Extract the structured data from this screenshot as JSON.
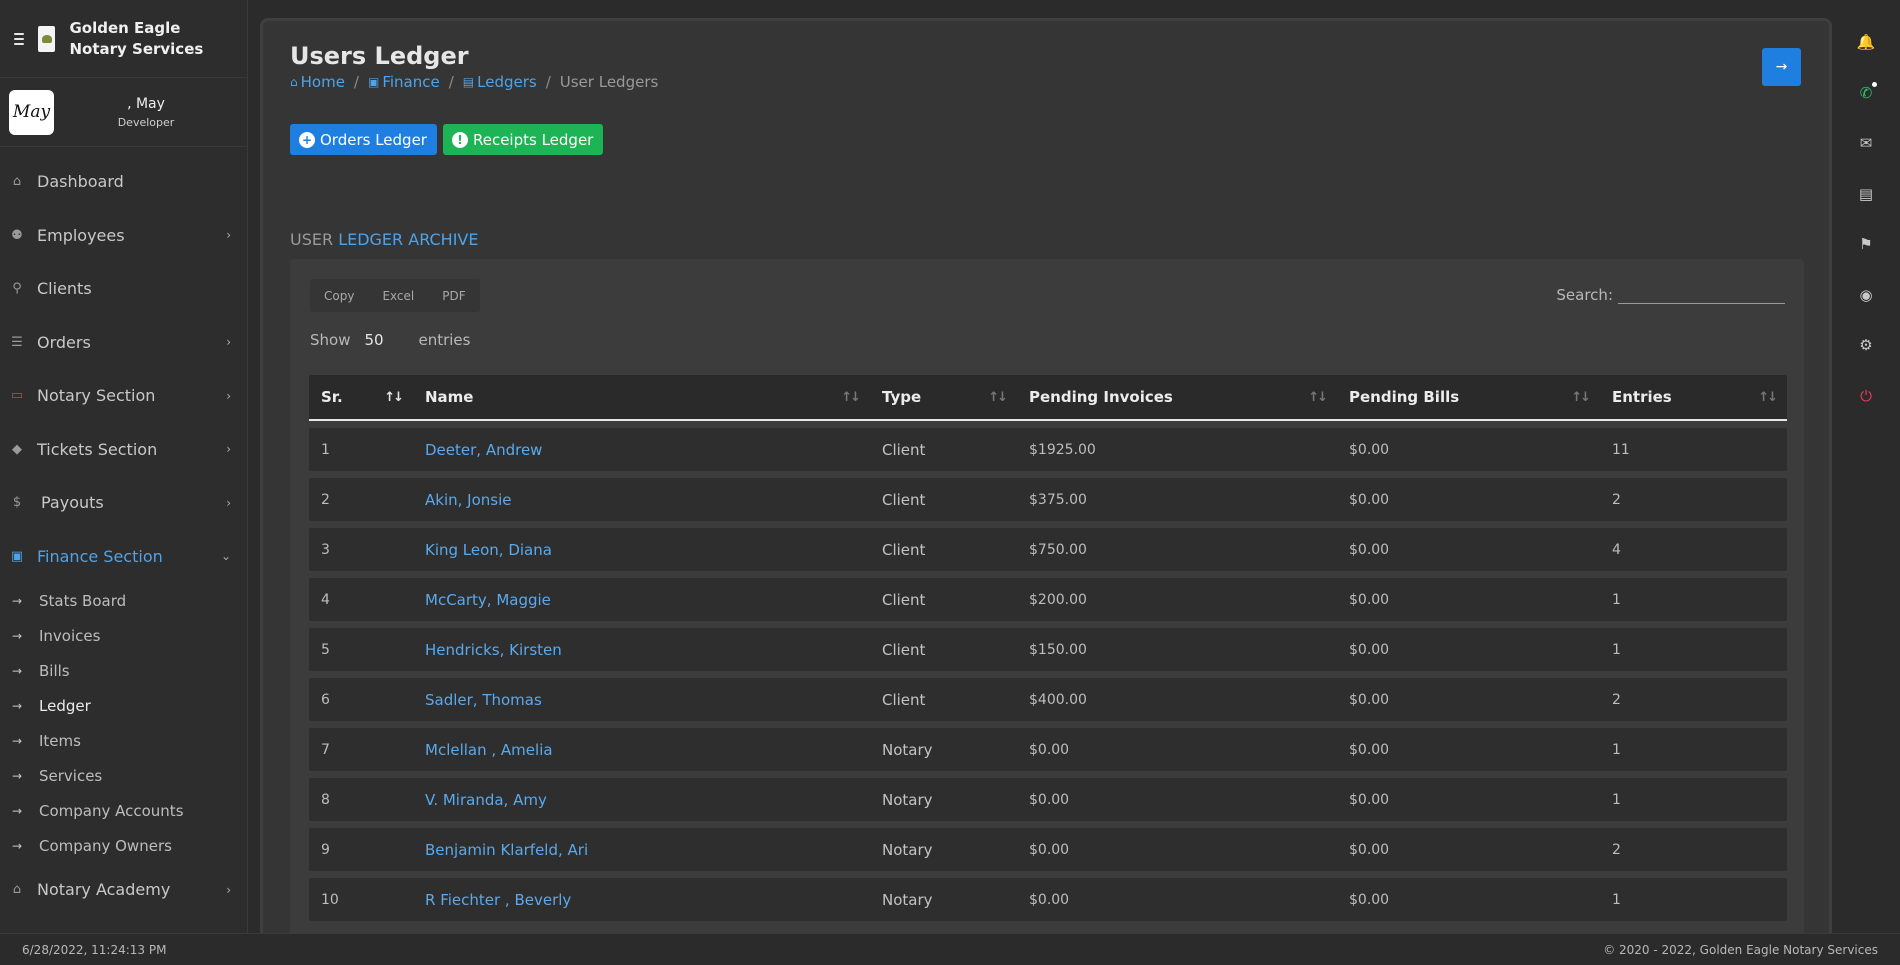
{
  "brand": {
    "name": "Golden Eagle Notary Services"
  },
  "user": {
    "name": ", May",
    "role": "Developer",
    "avatar_text": "May"
  },
  "sidebar": {
    "items": [
      {
        "label": "Dashboard",
        "icon": "home-icon",
        "glyph": "⌂",
        "chevron": ""
      },
      {
        "label": "Employees",
        "icon": "users-icon",
        "glyph": "⚉",
        "chevron": "›"
      },
      {
        "label": "Clients",
        "icon": "client-icon",
        "glyph": "⚲",
        "chevron": ""
      },
      {
        "label": "Orders",
        "icon": "orders-icon",
        "glyph": "☰",
        "chevron": "›"
      },
      {
        "label": "Notary Section",
        "icon": "id-card-icon",
        "glyph": "▭",
        "chevron": "›"
      },
      {
        "label": "Tickets Section",
        "icon": "ticket-icon",
        "glyph": "◆",
        "chevron": "›"
      },
      {
        "label": "Payouts",
        "icon": "dollar-icon",
        "glyph": "$",
        "chevron": "›"
      },
      {
        "label": "Finance Section",
        "icon": "finance-icon",
        "glyph": "▣",
        "chevron": "⌄"
      }
    ],
    "finance_sub": [
      {
        "label": "Stats Board"
      },
      {
        "label": "Invoices"
      },
      {
        "label": "Bills"
      },
      {
        "label": "Ledger"
      },
      {
        "label": "Items"
      },
      {
        "label": "Services"
      },
      {
        "label": "Company Accounts"
      },
      {
        "label": "Company Owners"
      }
    ],
    "academy": {
      "label": "Notary Academy",
      "icon": "academy-icon",
      "glyph": "⌂",
      "chevron": "›"
    },
    "sub_arrow": "→"
  },
  "header": {
    "title": "Users Ledger",
    "breadcrumb": {
      "home": "Home",
      "finance": "Finance",
      "ledgers": "Ledgers",
      "current": "User Ledgers",
      "separator": "/"
    }
  },
  "actions": {
    "orders_ledger": "Orders Ledger",
    "receipts_ledger": "Receipts Ledger"
  },
  "section": {
    "muted": "USER",
    "accent": "LEDGER ARCHIVE"
  },
  "toolbar": {
    "copy": "Copy",
    "excel": "Excel",
    "pdf": "PDF",
    "search_label": "Search:",
    "show_label": "Show",
    "show_value": "50",
    "entries_label": "entries"
  },
  "table": {
    "columns": [
      "Sr.",
      "Name",
      "Type",
      "Pending Invoices",
      "Pending Bills",
      "Entries"
    ],
    "rows": [
      {
        "sr": "1",
        "name": "Deeter, Andrew",
        "type": "Client",
        "invoices": "$1925.00",
        "bills": "$0.00",
        "entries": "11"
      },
      {
        "sr": "2",
        "name": "Akin, Jonsie",
        "type": "Client",
        "invoices": "$375.00",
        "bills": "$0.00",
        "entries": "2"
      },
      {
        "sr": "3",
        "name": "King Leon, Diana",
        "type": "Client",
        "invoices": "$750.00",
        "bills": "$0.00",
        "entries": "4"
      },
      {
        "sr": "4",
        "name": "McCarty, Maggie",
        "type": "Client",
        "invoices": "$200.00",
        "bills": "$0.00",
        "entries": "1"
      },
      {
        "sr": "5",
        "name": "Hendricks, Kirsten",
        "type": "Client",
        "invoices": "$150.00",
        "bills": "$0.00",
        "entries": "1"
      },
      {
        "sr": "6",
        "name": "Sadler, Thomas",
        "type": "Client",
        "invoices": "$400.00",
        "bills": "$0.00",
        "entries": "2"
      },
      {
        "sr": "7",
        "name": "Mclellan , Amelia",
        "type": "Notary",
        "invoices": "$0.00",
        "bills": "$0.00",
        "entries": "1"
      },
      {
        "sr": "8",
        "name": "V. Miranda, Amy",
        "type": "Notary",
        "invoices": "$0.00",
        "bills": "$0.00",
        "entries": "1"
      },
      {
        "sr": "9",
        "name": "Benjamin Klarfeld, Ari",
        "type": "Notary",
        "invoices": "$0.00",
        "bills": "$0.00",
        "entries": "2"
      },
      {
        "sr": "10",
        "name": "R Fiechter , Beverly",
        "type": "Notary",
        "invoices": "$0.00",
        "bills": "$0.00",
        "entries": "1"
      }
    ]
  },
  "rail": [
    {
      "icon": "bell-icon",
      "glyph": "🔔"
    },
    {
      "icon": "whatsapp-icon",
      "glyph": "✆"
    },
    {
      "icon": "chat-icon",
      "glyph": "✉"
    },
    {
      "icon": "book-icon",
      "glyph": "▤"
    },
    {
      "icon": "flag-icon",
      "glyph": "⚑"
    },
    {
      "icon": "user-circle-icon",
      "glyph": "◉"
    },
    {
      "icon": "settings-icon",
      "glyph": "⚙"
    },
    {
      "icon": "power-icon",
      "glyph": "⏻"
    }
  ],
  "footer": {
    "timestamp": "6/28/2022, 11:24:13 PM",
    "copyright": "© 2020 - 2022, Golden Eagle Notary Services"
  },
  "colors": {
    "accent": "#4ea3e8",
    "primary_button": "#1f7fe0",
    "success_button": "#1cb454",
    "danger": "#e23b58"
  }
}
